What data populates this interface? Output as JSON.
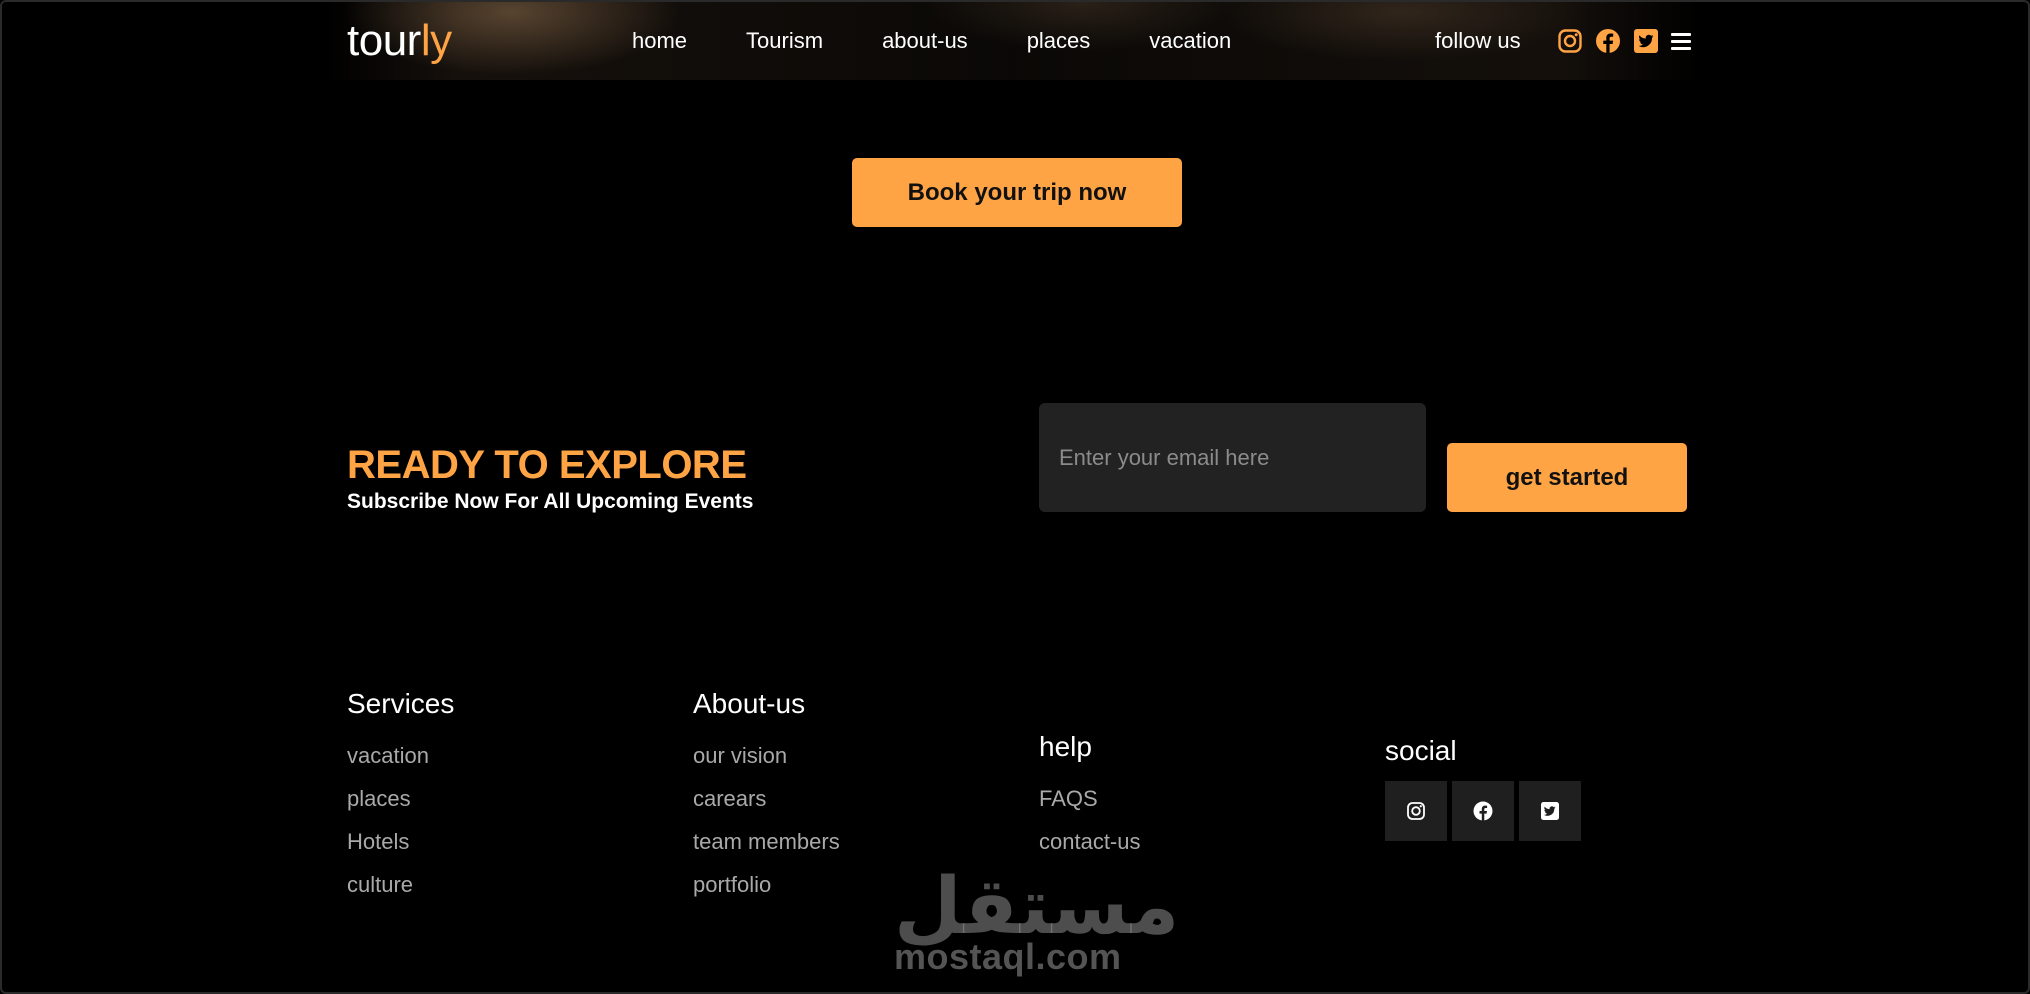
{
  "header": {
    "logo_main": "tour",
    "logo_accent": "ly",
    "nav": [
      "home",
      "Tourism",
      "about-us",
      "places",
      "vacation"
    ],
    "follow_label": "follow us",
    "icons": [
      "instagram-icon",
      "facebook-icon",
      "twitter-icon",
      "menu-icon"
    ]
  },
  "hero": {
    "book_label": "Book your trip now"
  },
  "subscribe": {
    "title": "READY TO EXPLORE",
    "subtitle": "Subscribe Now For All Upcoming Events",
    "email_placeholder": "Enter your email here",
    "button_label": "get started"
  },
  "footer": {
    "services": {
      "title": "Services",
      "links": [
        "vacation",
        "places",
        "Hotels",
        "culture"
      ]
    },
    "about": {
      "title": "About-us",
      "links": [
        "our vision",
        "carears",
        "team members",
        "portfolio"
      ]
    },
    "help": {
      "title": "help",
      "links": [
        "FAQS",
        "contact-us"
      ]
    },
    "social": {
      "title": "social",
      "icons": [
        "instagram-icon",
        "facebook-icon",
        "twitter-icon"
      ]
    }
  },
  "watermark": {
    "arabic": "مستقل",
    "latin": "mostaql.com"
  },
  "colors": {
    "accent": "#ffa445",
    "background": "#000000",
    "input_bg": "#222222",
    "social_box_bg": "#1f1f1f"
  }
}
